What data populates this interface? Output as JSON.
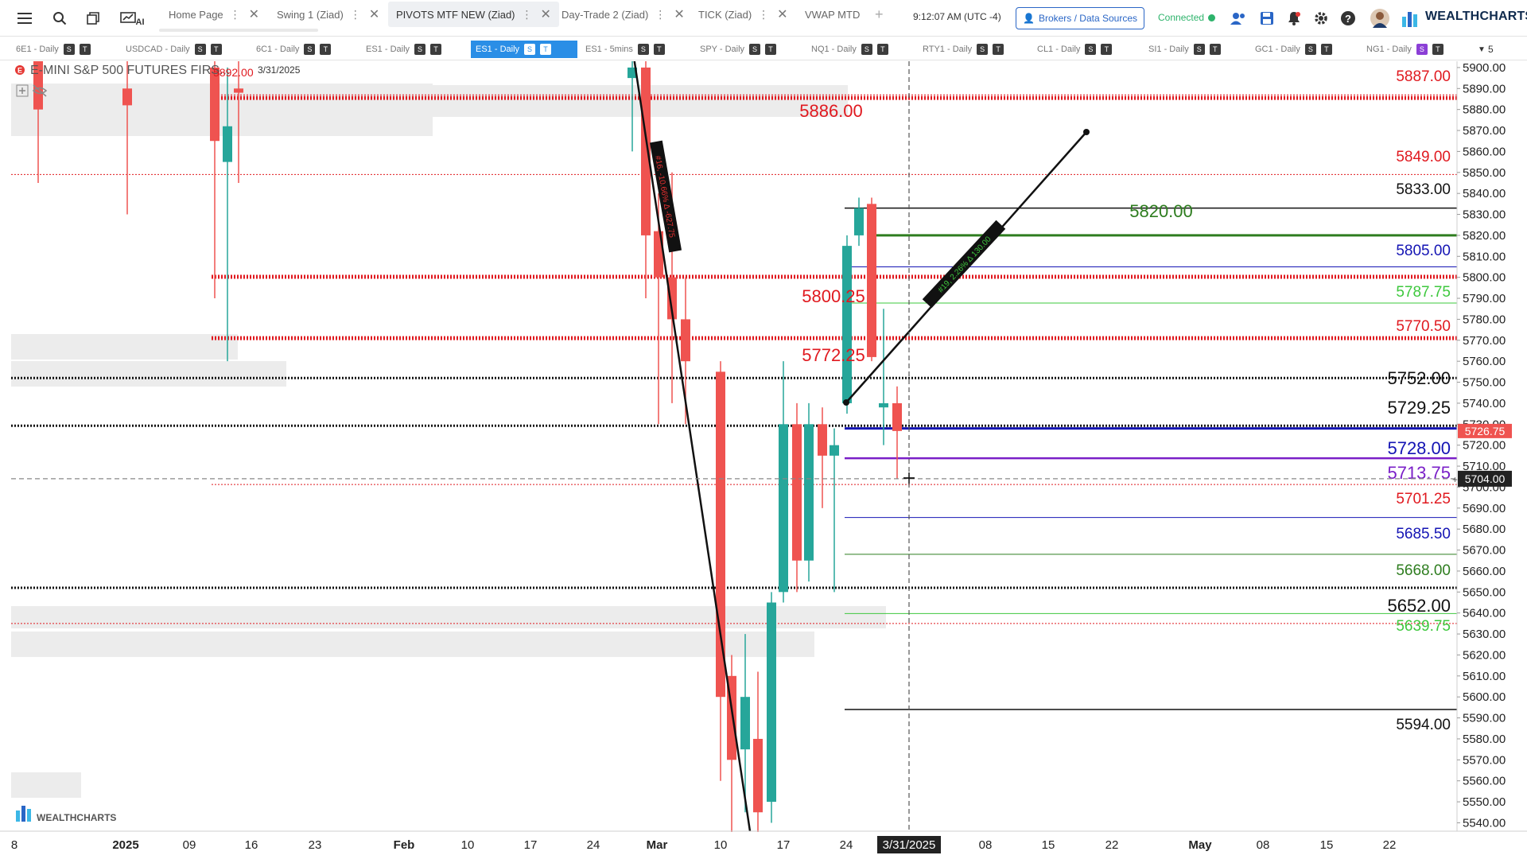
{
  "toolbar": {
    "tabs": [
      {
        "label": "Home Page",
        "active": false
      },
      {
        "label": "Swing 1 (Ziad)",
        "active": false
      },
      {
        "label": "PIVOTS MTF NEW (Ziad)",
        "active": true
      },
      {
        "label": "Day-Trade 2 (Ziad)",
        "active": false
      },
      {
        "label": "TICK (Ziad)",
        "active": false
      },
      {
        "label": "VWAP MTD",
        "active": false
      }
    ],
    "add_tab": "+",
    "ai_label": "AI",
    "clock": "9:12:07 AM  (UTC -4)",
    "brokers_label": "Brokers / Data Sources",
    "connected_label": "Connected",
    "logo_text": "WEALTHCHARTS"
  },
  "symbols": [
    {
      "label": "6E1 - Daily",
      "badges": [
        "S",
        "T"
      ],
      "active": false
    },
    {
      "label": "USDCAD - Daily",
      "badges": [
        "S",
        "T"
      ],
      "active": false
    },
    {
      "label": "6C1 - Daily",
      "badges": [
        "S",
        "T"
      ],
      "active": false
    },
    {
      "label": "ES1 - Daily",
      "badges": [
        "S",
        "T"
      ],
      "active": false
    },
    {
      "label": "ES1 - Daily",
      "badges": [
        "S",
        "T"
      ],
      "active": true
    },
    {
      "label": "ES1 - 5mins",
      "badges": [
        "S",
        "T"
      ],
      "active": false
    },
    {
      "label": "SPY - Daily",
      "badges": [
        "S",
        "T"
      ],
      "active": false
    },
    {
      "label": "NQ1 - Daily",
      "badges": [
        "S",
        "T"
      ],
      "active": false
    },
    {
      "label": "RTY1 - Daily",
      "badges": [
        "S",
        "T"
      ],
      "active": false
    },
    {
      "label": "CL1 - Daily",
      "badges": [
        "S",
        "T"
      ],
      "active": false
    },
    {
      "label": "SI1 - Daily",
      "badges": [
        "S",
        "T"
      ],
      "active": false
    },
    {
      "label": "GC1 - Daily",
      "badges": [
        "S",
        "T"
      ],
      "active": false
    },
    {
      "label": "NG1 - Daily",
      "badges": [
        "S",
        "T"
      ],
      "active": false
    }
  ],
  "symbols_more": "5",
  "chart": {
    "instrument": "E-MINI S&P 500 FUTURES FIRS...",
    "instrument_badge": "E",
    "header_price": "5892.00",
    "header_date": "3/31/2025",
    "watermark": "WEALTHCHARTS",
    "colors": {
      "up": "#26a69a",
      "down": "#ef5350",
      "red_level": "#e0191f",
      "green_level": "#2e7d1f",
      "blue_level": "#1414b4",
      "lime_level": "#3ec83e",
      "purple_level": "#7a1fc8"
    },
    "y_ticks": [
      "5900.00",
      "5890.00",
      "5880.00",
      "5870.00",
      "5860.00",
      "5850.00",
      "5840.00",
      "5830.00",
      "5820.00",
      "5810.00",
      "5800.00",
      "5790.00",
      "5780.00",
      "5770.00",
      "5760.00",
      "5750.00",
      "5740.00",
      "5730.00",
      "5720.00",
      "5710.00",
      "5700.00",
      "5690.00",
      "5680.00",
      "5670.00",
      "5660.00",
      "5650.00",
      "5640.00",
      "5630.00",
      "5620.00",
      "5610.00",
      "5600.00",
      "5590.00",
      "5580.00",
      "5570.00",
      "5560.00",
      "5550.00",
      "5540.00"
    ],
    "x_ticks": [
      "8",
      "2025",
      "09",
      "16",
      "23",
      "Feb",
      "10",
      "17",
      "24",
      "Mar",
      "10",
      "17",
      "24",
      "08",
      "15",
      "22",
      "May",
      "08",
      "15",
      "22"
    ],
    "x_cursor_label": "3/31/2025",
    "price_tag_current": "5726.75",
    "price_tag_cursor": "5704.00",
    "levels": [
      {
        "label": "5887.00",
        "price": 5887,
        "color": "red"
      },
      {
        "label": "5886.00",
        "price": 5886,
        "color": "red"
      },
      {
        "label": "5849.00",
        "price": 5849,
        "color": "red"
      },
      {
        "label": "5833.00",
        "price": 5833,
        "color": "black"
      },
      {
        "label": "5820.00",
        "price": 5820,
        "color": "green"
      },
      {
        "label": "5805.00",
        "price": 5805,
        "color": "blue"
      },
      {
        "label": "5800.25",
        "price": 5800.25,
        "color": "red"
      },
      {
        "label": "5787.75",
        "price": 5787.75,
        "color": "lime"
      },
      {
        "label": "5772.25",
        "price": 5772.25,
        "color": "red"
      },
      {
        "label": "5770.50",
        "price": 5770.5,
        "color": "red"
      },
      {
        "label": "5752.00",
        "price": 5752,
        "color": "black"
      },
      {
        "label": "5729.25",
        "price": 5729.25,
        "color": "black"
      },
      {
        "label": "5728.00",
        "price": 5728,
        "color": "blue"
      },
      {
        "label": "5713.75",
        "price": 5713.75,
        "color": "purple"
      },
      {
        "label": "5701.25",
        "price": 5701.25,
        "color": "red"
      },
      {
        "label": "5685.50",
        "price": 5685.5,
        "color": "blue"
      },
      {
        "label": "5668.00",
        "price": 5668,
        "color": "green"
      },
      {
        "label": "5652.00",
        "price": 5652,
        "color": "black"
      },
      {
        "label": "5639.75",
        "price": 5639.75,
        "color": "lime"
      },
      {
        "label": "5594.00",
        "price": 5594,
        "color": "black"
      }
    ],
    "trend_down_label": "#16, -10.66% Δ -627.75",
    "trend_up_label": "#19, 2.26% Δ 130.00",
    "candles": [
      {
        "t": 0,
        "o": 5905,
        "h": 5930,
        "l": 5845,
        "c": 5880
      },
      {
        "t": 1,
        "o": 5890,
        "h": 5935,
        "l": 5830,
        "c": 5882
      },
      {
        "t": 2,
        "o": 5900,
        "h": 5910,
        "l": 5790,
        "c": 5865
      },
      {
        "t": 3,
        "o": 5855,
        "h": 5900,
        "l": 5760,
        "c": 5872
      },
      {
        "t": 4,
        "o": 5890,
        "h": 5905,
        "l": 5845,
        "c": 5888
      },
      {
        "t": 5,
        "o": 5895,
        "h": 5935,
        "l": 5860,
        "c": 5900
      },
      {
        "t": 6,
        "o": 5900,
        "h": 5925,
        "l": 5790,
        "c": 5820
      },
      {
        "t": 7,
        "o": 5822,
        "h": 5840,
        "l": 5730,
        "c": 5800
      },
      {
        "t": 8,
        "o": 5800,
        "h": 5850,
        "l": 5740,
        "c": 5780
      },
      {
        "t": 9,
        "o": 5780,
        "h": 5800,
        "l": 5730,
        "c": 5760
      },
      {
        "t": 10,
        "o": 5755,
        "h": 5760,
        "l": 5560,
        "c": 5600
      },
      {
        "t": 11,
        "o": 5610,
        "h": 5620,
        "l": 5520,
        "c": 5570
      },
      {
        "t": 12,
        "o": 5575,
        "h": 5630,
        "l": 5545,
        "c": 5600
      },
      {
        "t": 13,
        "o": 5580,
        "h": 5612,
        "l": 5515,
        "c": 5545
      },
      {
        "t": 14,
        "o": 5550,
        "h": 5650,
        "l": 5540,
        "c": 5645
      },
      {
        "t": 15,
        "o": 5650,
        "h": 5760,
        "l": 5645,
        "c": 5730
      },
      {
        "t": 16,
        "o": 5730,
        "h": 5740,
        "l": 5650,
        "c": 5665
      },
      {
        "t": 17,
        "o": 5665,
        "h": 5740,
        "l": 5655,
        "c": 5730
      },
      {
        "t": 18,
        "o": 5730,
        "h": 5738,
        "l": 5690,
        "c": 5715
      },
      {
        "t": 19,
        "o": 5715,
        "h": 5728,
        "l": 5650,
        "c": 5720
      },
      {
        "t": 20,
        "o": 5740,
        "h": 5820,
        "l": 5735,
        "c": 5815
      },
      {
        "t": 21,
        "o": 5820,
        "h": 5838,
        "l": 5815,
        "c": 5833
      },
      {
        "t": 22,
        "o": 5835,
        "h": 5838,
        "l": 5760,
        "c": 5762
      },
      {
        "t": 23,
        "o": 5738,
        "h": 5785,
        "l": 5720,
        "c": 5740
      },
      {
        "t": 24,
        "o": 5740,
        "h": 5748,
        "l": 5704,
        "c": 5726.75
      }
    ]
  }
}
